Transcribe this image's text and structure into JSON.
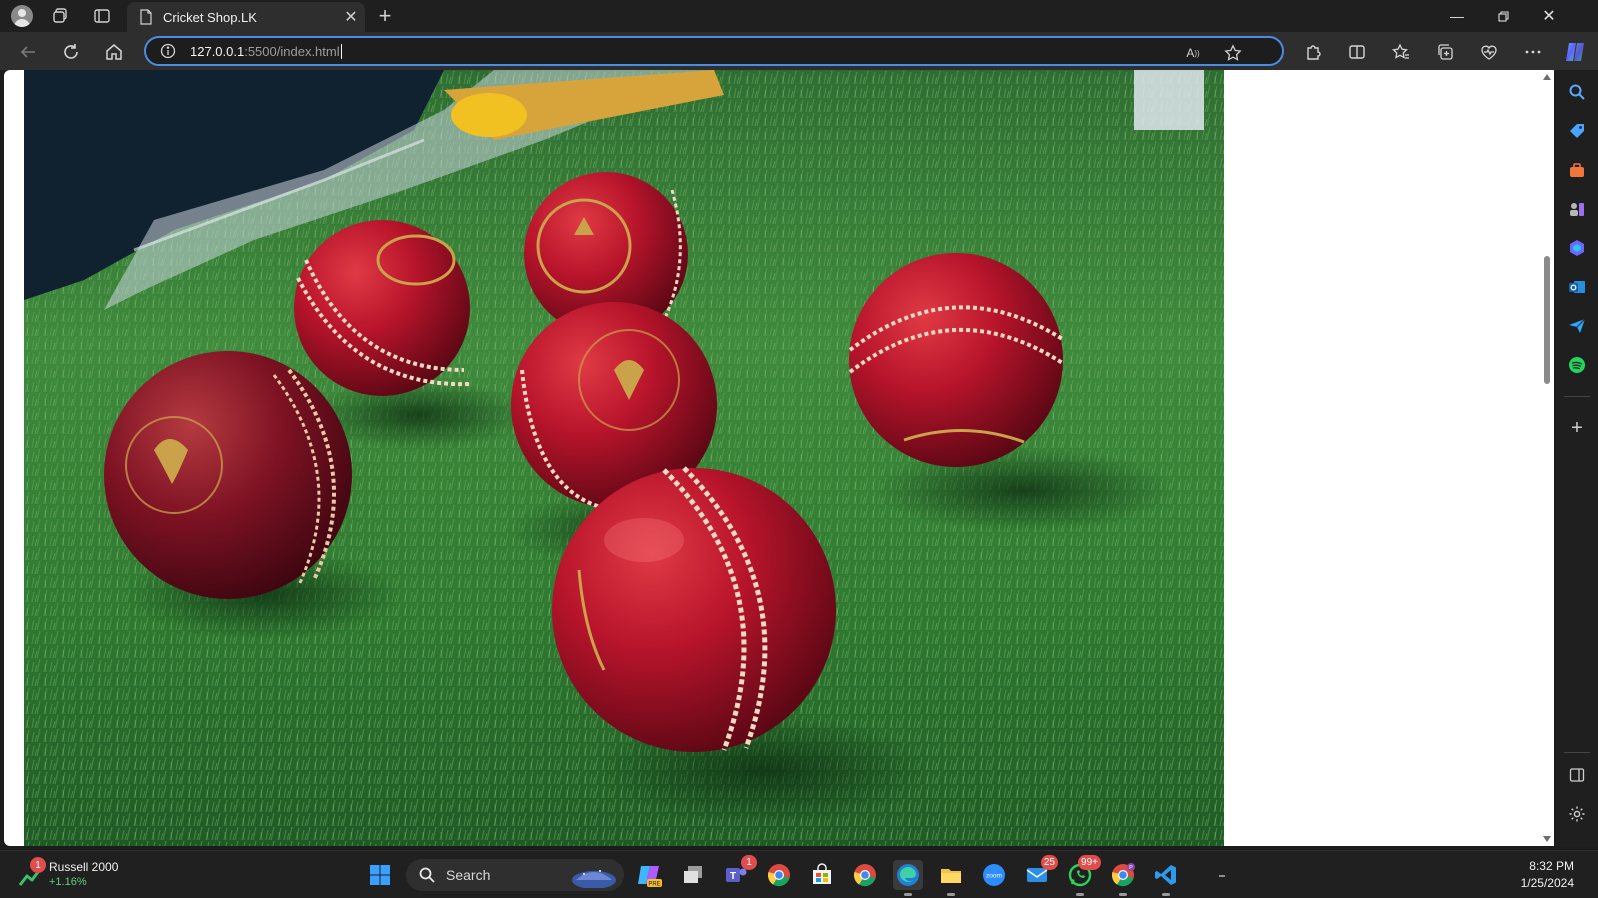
{
  "browser": {
    "tab_title": "Cricket Shop.LK",
    "url_host": "127.0.0.1",
    "url_rest": ":5500/index.html",
    "accent": "#4a8ee3"
  },
  "page": {
    "hero_image_desc": "cricket-balls-on-grass"
  },
  "taskbar": {
    "widget_name": "Russell 2000",
    "widget_change": "+1.16%",
    "widget_badge": "1",
    "search_label": "Search",
    "teams_badge": "1",
    "mail_badge": "25",
    "whatsapp_badge": "99+",
    "time": "8:32 PM",
    "date": "1/25/2024"
  },
  "icons": [
    "profile-icon",
    "workspaces-icon",
    "tab-actions-icon",
    "new-tab-icon",
    "back-icon",
    "refresh-icon",
    "home-icon",
    "site-info-icon",
    "read-aloud-icon",
    "favorite-star-icon",
    "extensions-icon",
    "split-screen-icon",
    "favorites-icon",
    "collections-icon",
    "browser-essentials-icon",
    "more-icon",
    "copilot-icon"
  ]
}
